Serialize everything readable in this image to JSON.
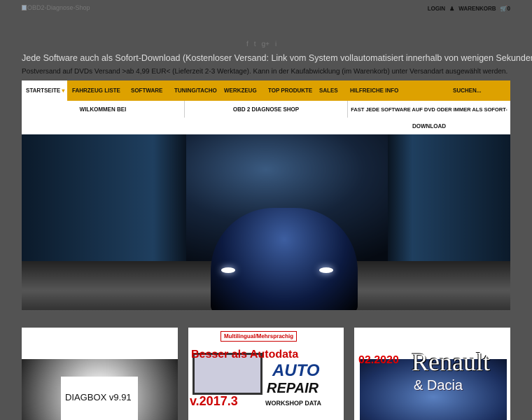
{
  "header": {
    "logo_alt": "OBD2-Diagnose-Shop",
    "login": "LOGIN",
    "cart": "WARENKORB",
    "cart_count": "0"
  },
  "social": [
    "f",
    "t",
    "g+",
    "i"
  ],
  "notice": {
    "line1": "Jede Software auch als Sofort-Download (Kostenloser Versand: Link vom System vollautomatisiert innerhalb von wenigen Sekunden).",
    "line2": "Postversand auf DVDs Versand >ab 4,99 EUR< (Lieferzeit 2-3 Werktage). Kann in der Kaufabwicklung (im Warenkorb) unter Versandart ausgewählt werden."
  },
  "nav": {
    "items": [
      "STARTSEITE",
      "FAHRZEUG LISTE",
      "SOFTWARE",
      "TUNING/TACHO",
      "WERKZEUG",
      "TOP PRODUKTE",
      "SALES",
      "HILFREICHE INFO"
    ],
    "search": "SUCHEN...",
    "accent": "#dda100"
  },
  "submenu": {
    "col1": "WILKOMMEN BEI",
    "col2": "OBD 2 DIAGNOSE SHOP",
    "col3a": "FAST JEDE SOFTWARE AUF DVD ODER IMMER ALS SOFORT-",
    "col3b": "DOWNLOAD"
  },
  "products": [
    {
      "title": "DIAGBOX v9.91"
    },
    {
      "tag": "Multilingual/Mehrsprachig",
      "headline": "Besser als Autodata",
      "auto": "AUTO",
      "repair": "REPAIR",
      "workshop": "WORKSHOP DATA",
      "version": "v.2017.3"
    },
    {
      "year": "02.2020",
      "brand": "Renault",
      "sub": "& Dacia"
    }
  ]
}
